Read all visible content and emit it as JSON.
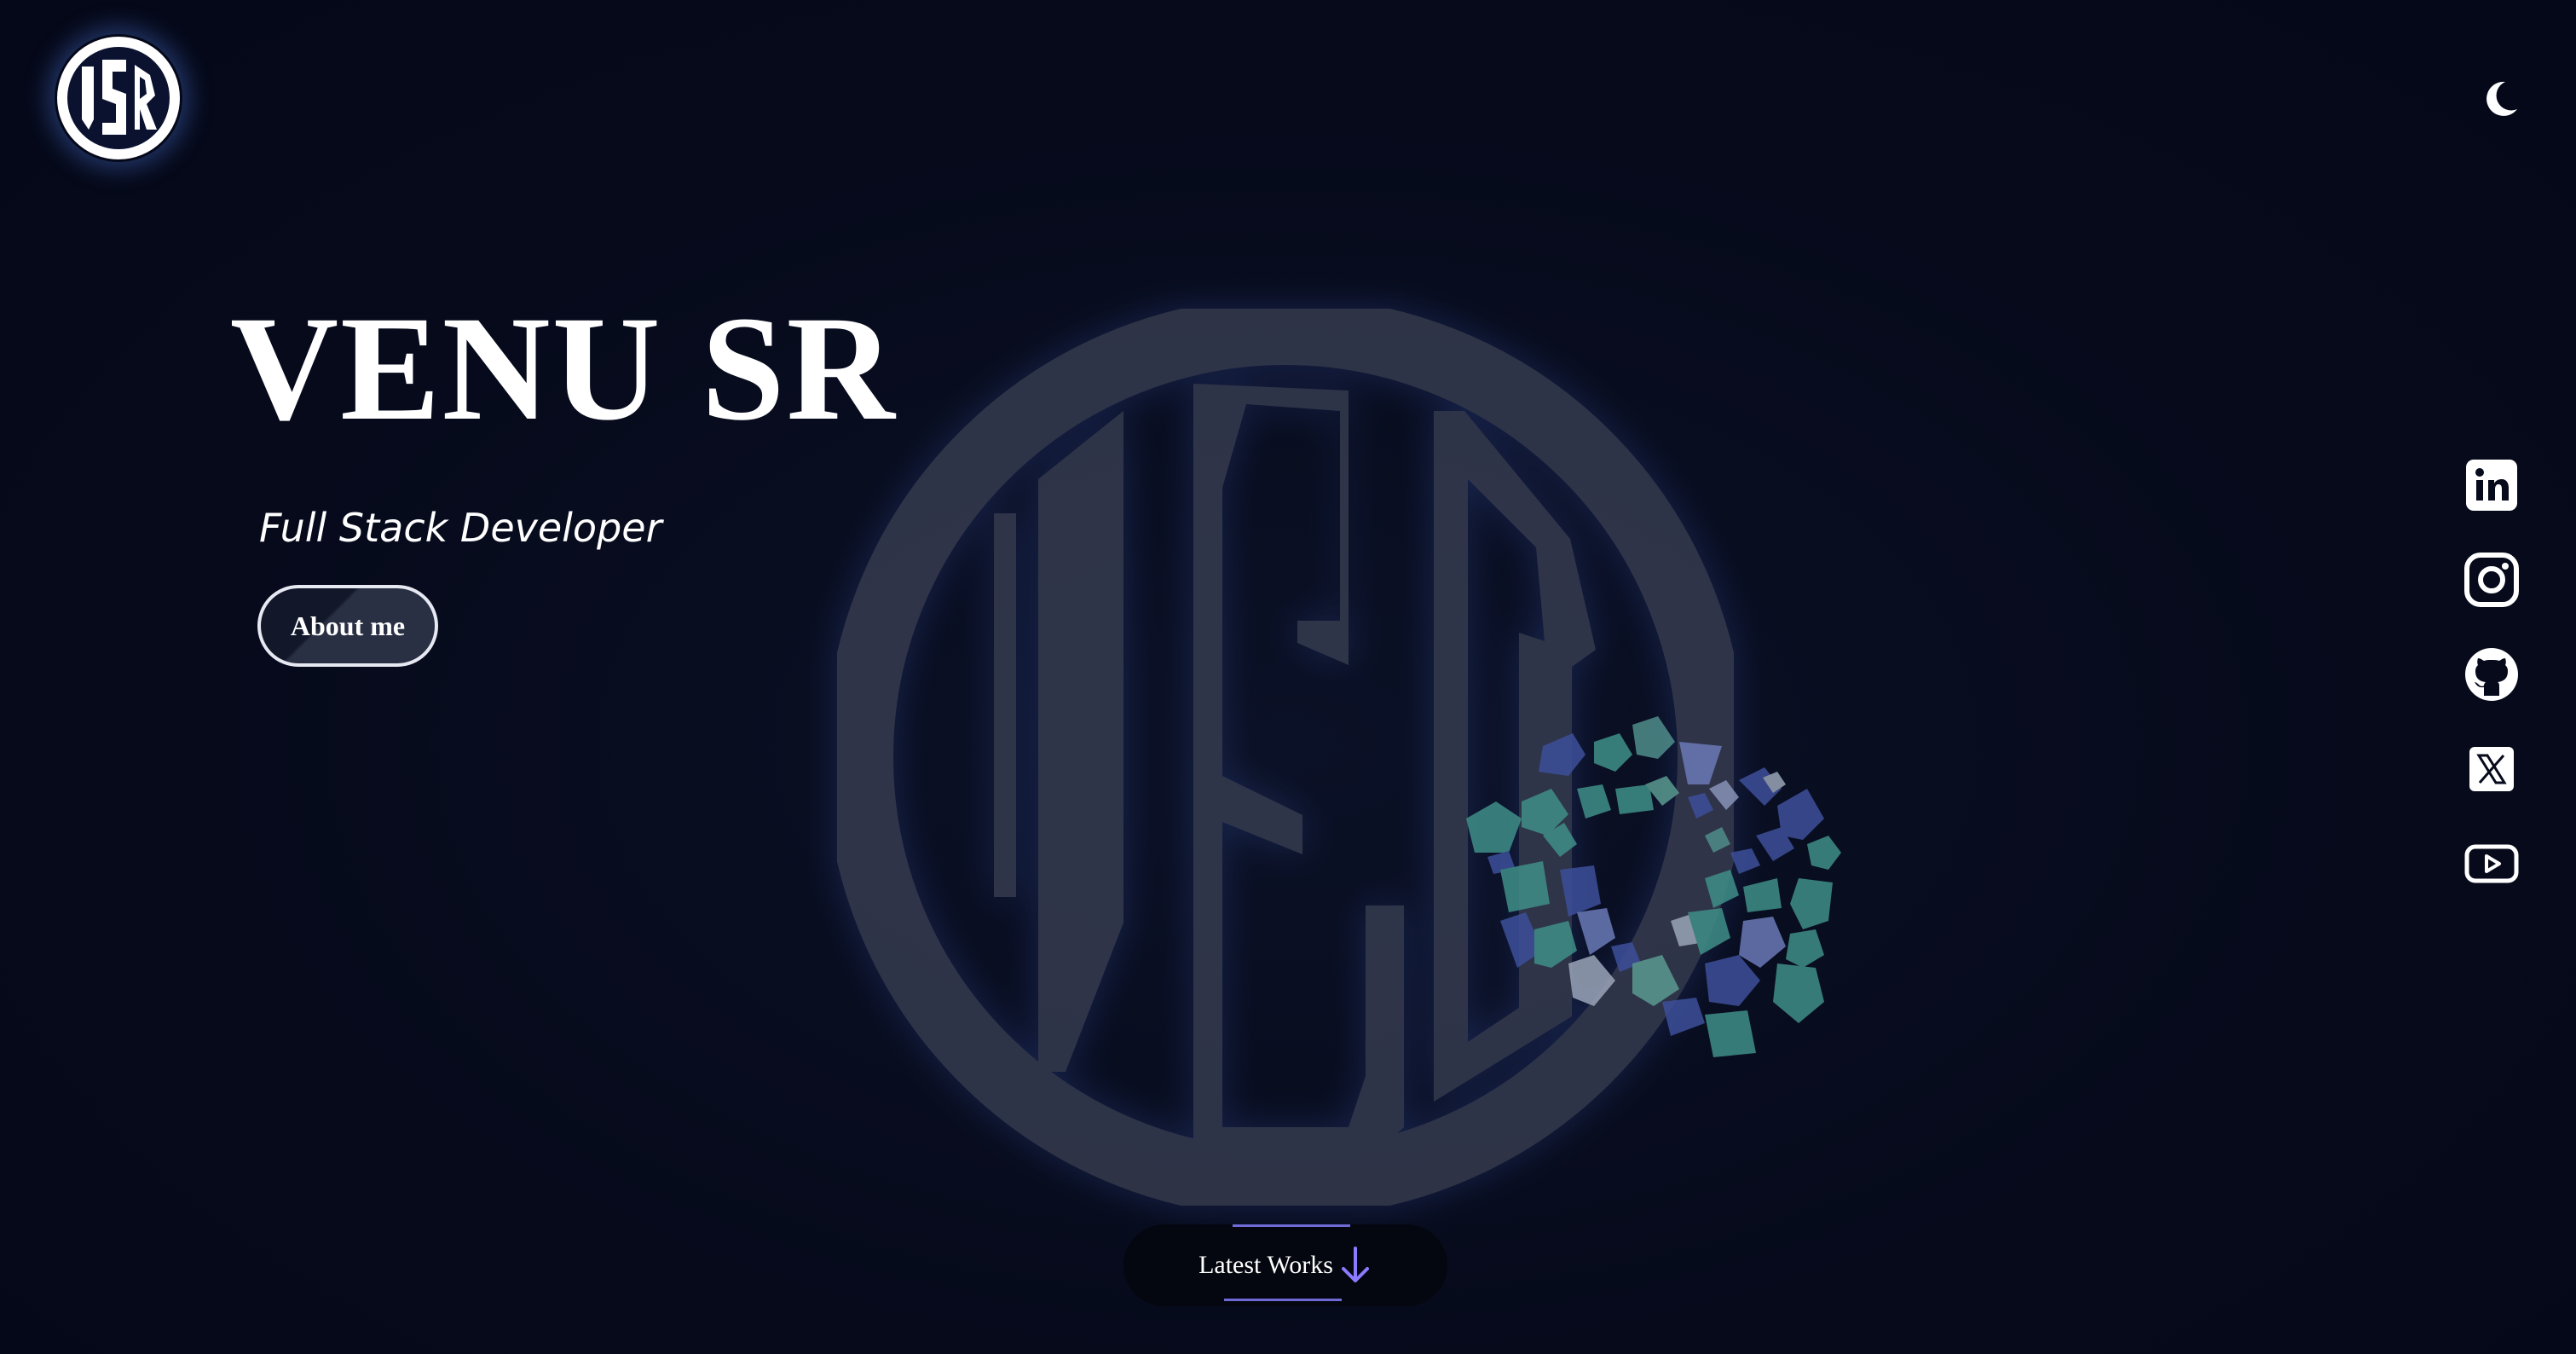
{
  "header": {
    "logo_text": "VSR",
    "theme_toggle_icon": "moon-icon"
  },
  "hero": {
    "name": "VENU SR",
    "role": "Full Stack Developer",
    "about_button_label": "About me"
  },
  "watermark": {
    "emblem_text": "VSR"
  },
  "socials": [
    {
      "name": "linkedin",
      "icon": "linkedin-icon"
    },
    {
      "name": "instagram",
      "icon": "instagram-icon"
    },
    {
      "name": "github",
      "icon": "github-icon"
    },
    {
      "name": "x",
      "icon": "x-icon"
    },
    {
      "name": "youtube",
      "icon": "youtube-icon"
    }
  ],
  "footer": {
    "latest_works_label": "Latest Works",
    "latest_works_icon": "arrow-down-icon"
  },
  "colors": {
    "background": "#060a1b",
    "text": "#ffffff",
    "accent": "#8b7bff",
    "polygon_teal": "#3f8f88",
    "polygon_blue": "#3d4f9a"
  }
}
